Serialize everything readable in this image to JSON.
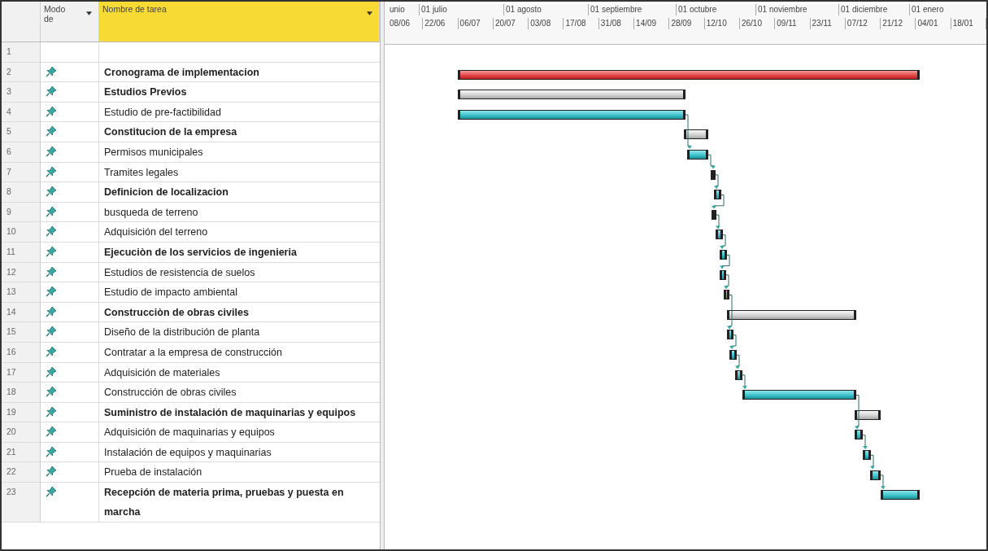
{
  "table": {
    "columns": [
      {
        "label": "Modo de",
        "selected": false
      },
      {
        "label": "Nombre de tarea",
        "selected": true
      }
    ],
    "rows": [
      {
        "number": "1",
        "pinned": false,
        "kind": "none"
      },
      {
        "number": "2",
        "pinned": true,
        "name": "Cronograma de implementacion",
        "summary": true,
        "kind": "project"
      },
      {
        "number": "3",
        "pinned": true,
        "name": "Estudios Previos",
        "summary": true,
        "kind": "summary"
      },
      {
        "number": "4",
        "pinned": true,
        "name": "Estudio de pre-factibilidad",
        "summary": false,
        "kind": "task"
      },
      {
        "number": "5",
        "pinned": true,
        "name": "Constitucion de la empresa",
        "summary": true,
        "kind": "summary"
      },
      {
        "number": "6",
        "pinned": true,
        "name": "Permisos municipales",
        "summary": false,
        "kind": "task"
      },
      {
        "number": "7",
        "pinned": true,
        "name": "Tramites legales",
        "summary": false,
        "kind": "task"
      },
      {
        "number": "8",
        "pinned": true,
        "name": "Definicion de localizacion",
        "summary": true,
        "kind": "task"
      },
      {
        "number": "9",
        "pinned": true,
        "name": "busqueda de terreno",
        "summary": false,
        "kind": "task"
      },
      {
        "number": "10",
        "pinned": true,
        "name": "Adquisición del terreno",
        "summary": false,
        "kind": "task"
      },
      {
        "number": "11",
        "pinned": true,
        "name": "Ejecuciòn de los servicios de ingenieria",
        "summary": true,
        "kind": "task"
      },
      {
        "number": "12",
        "pinned": true,
        "name": "Estudios de resistencia de suelos",
        "summary": false,
        "kind": "task"
      },
      {
        "number": "13",
        "pinned": true,
        "name": "Estudio de impacto ambiental",
        "summary": false,
        "kind": "task"
      },
      {
        "number": "14",
        "pinned": true,
        "name": "Construcciòn de obras civiles",
        "summary": true,
        "kind": "summary"
      },
      {
        "number": "15",
        "pinned": true,
        "name": "Diseño de la distribución de planta",
        "summary": false,
        "kind": "task"
      },
      {
        "number": "16",
        "pinned": true,
        "name": "Contratar a la empresa de construcción",
        "summary": false,
        "kind": "task"
      },
      {
        "number": "17",
        "pinned": true,
        "name": "Adquisición de materiales",
        "summary": false,
        "kind": "task"
      },
      {
        "number": "18",
        "pinned": true,
        "name": "Construcción de obras civiles",
        "summary": false,
        "kind": "task"
      },
      {
        "number": "19",
        "pinned": true,
        "name": "Suministro de instalación de maquinarias y equipos",
        "summary": true,
        "kind": "summary"
      },
      {
        "number": "20",
        "pinned": true,
        "name": "Adquisición de maquinarias y equipos",
        "summary": false,
        "kind": "task"
      },
      {
        "number": "21",
        "pinned": true,
        "name": "Instalación de equipos y maquinarias",
        "summary": false,
        "kind": "task"
      },
      {
        "number": "22",
        "pinned": true,
        "name": "Prueba de instalación",
        "summary": false,
        "kind": "task"
      },
      {
        "number": "23",
        "pinned": true,
        "name": "Recepción de materia prima, pruebas y puesta en marcha",
        "summary": true,
        "kind": "task"
      }
    ]
  },
  "timescale": {
    "months": [
      "unio",
      "01 julio",
      "01 agosto",
      "01 septiembre",
      "01 octubre",
      "01 noviembre",
      "01 diciembre",
      "01 enero"
    ],
    "weeks": [
      "08/06",
      "22/06",
      "06/07",
      "20/07",
      "03/08",
      "17/08",
      "31/08",
      "14/09",
      "28/09",
      "12/10",
      "26/10",
      "09/11",
      "23/11",
      "07/12",
      "21/12",
      "04/01",
      "18/01"
    ]
  }
}
